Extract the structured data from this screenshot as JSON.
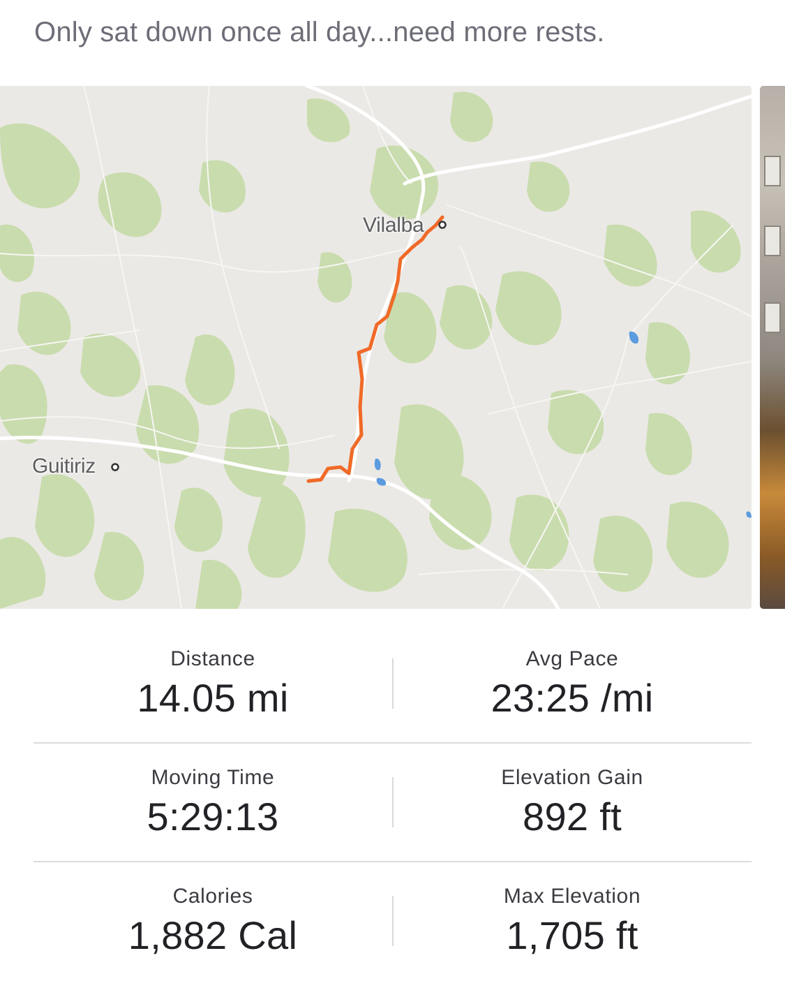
{
  "activity": {
    "description": "Only sat down once all day...need more rests."
  },
  "map": {
    "towns": [
      {
        "name": "Vilalba"
      },
      {
        "name": "Guitiriz"
      }
    ],
    "route_color": "#f06a28",
    "water_color": "#5b9bdf",
    "vegetation_color": "#c9dcae"
  },
  "stats": [
    {
      "label": "Distance",
      "value": "14.05 mi"
    },
    {
      "label": "Avg Pace",
      "value": "23:25 /mi"
    },
    {
      "label": "Moving Time",
      "value": "5:29:13"
    },
    {
      "label": "Elevation Gain",
      "value": "892 ft"
    },
    {
      "label": "Calories",
      "value": "1,882 Cal"
    },
    {
      "label": "Max Elevation",
      "value": "1,705 ft"
    }
  ]
}
